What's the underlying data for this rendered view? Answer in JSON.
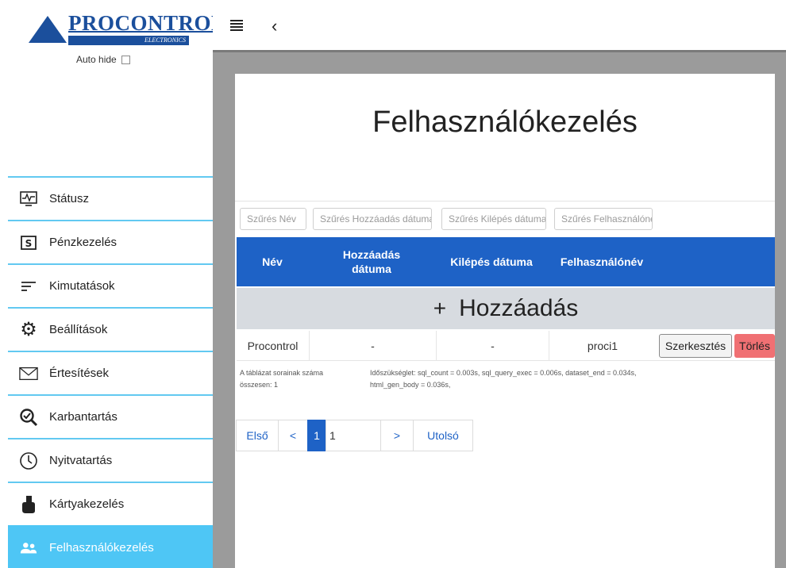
{
  "brand": {
    "name": "PROCONTROL",
    "sub": "ELECTRONICS"
  },
  "sidebar": {
    "autohide_label": "Auto hide",
    "items": [
      {
        "label": "Státusz",
        "icon": "monitor-pulse-icon",
        "glyph": "⌇"
      },
      {
        "label": "Pénzkezelés",
        "icon": "money-icon",
        "glyph": "$"
      },
      {
        "label": "Kimutatások",
        "icon": "list-lines-icon",
        "glyph": "≡"
      },
      {
        "label": "Beállítások",
        "icon": "gear-icon",
        "glyph": "⚙"
      },
      {
        "label": "Értesítések",
        "icon": "envelope-icon",
        "glyph": "✉"
      },
      {
        "label": "Karbantartás",
        "icon": "search-check-icon",
        "glyph": "✓"
      },
      {
        "label": "Nyitvatartás",
        "icon": "clock-icon",
        "glyph": "◷"
      },
      {
        "label": "Kártyakezelés",
        "icon": "card-hand-icon",
        "glyph": "✋"
      },
      {
        "label": "Felhasználókezelés",
        "icon": "users-icon",
        "glyph": "☺"
      }
    ],
    "active_index": 8
  },
  "topbar": {
    "menu_icon": "hamburger-icon",
    "back_icon": "chevron-left-icon",
    "back_glyph": "‹"
  },
  "page": {
    "title": "Felhasználókezelés"
  },
  "filters": {
    "name": "Szűrés Név",
    "added": "Szűrés Hozzáadás dátuma",
    "left": "Szűrés Kilépés dátuma",
    "user": "Szűrés Felhasználónév"
  },
  "table": {
    "headers": {
      "name": "Név",
      "added": "Hozzáadás dátuma",
      "left": "Kilépés dátuma",
      "user": "Felhasználónév"
    },
    "add_label": "Hozzáadás",
    "add_symbol": "+",
    "rows": [
      {
        "name": "Procontrol",
        "added": "-",
        "left": "-",
        "user": "proci1"
      }
    ],
    "edit_label": "Szerkesztés",
    "delete_label": "Törlés"
  },
  "meta": {
    "row_count_line1": "A táblázat sorainak száma",
    "row_count_line2": "összesen: 1",
    "timing_line1": "Időszükséglet: sql_count = 0.003s, sql_query_exec = 0.006s, dataset_end = 0.034s,",
    "timing_line2": "html_gen_body = 0.036s,"
  },
  "pager": {
    "first": "Első",
    "prev": "<",
    "current": "1",
    "input_value": "1",
    "next": ">",
    "last": "Utolsó"
  },
  "colors": {
    "accent": "#1e62c6",
    "sidebar_active": "#4ec6f5",
    "delete": "#f07073"
  }
}
